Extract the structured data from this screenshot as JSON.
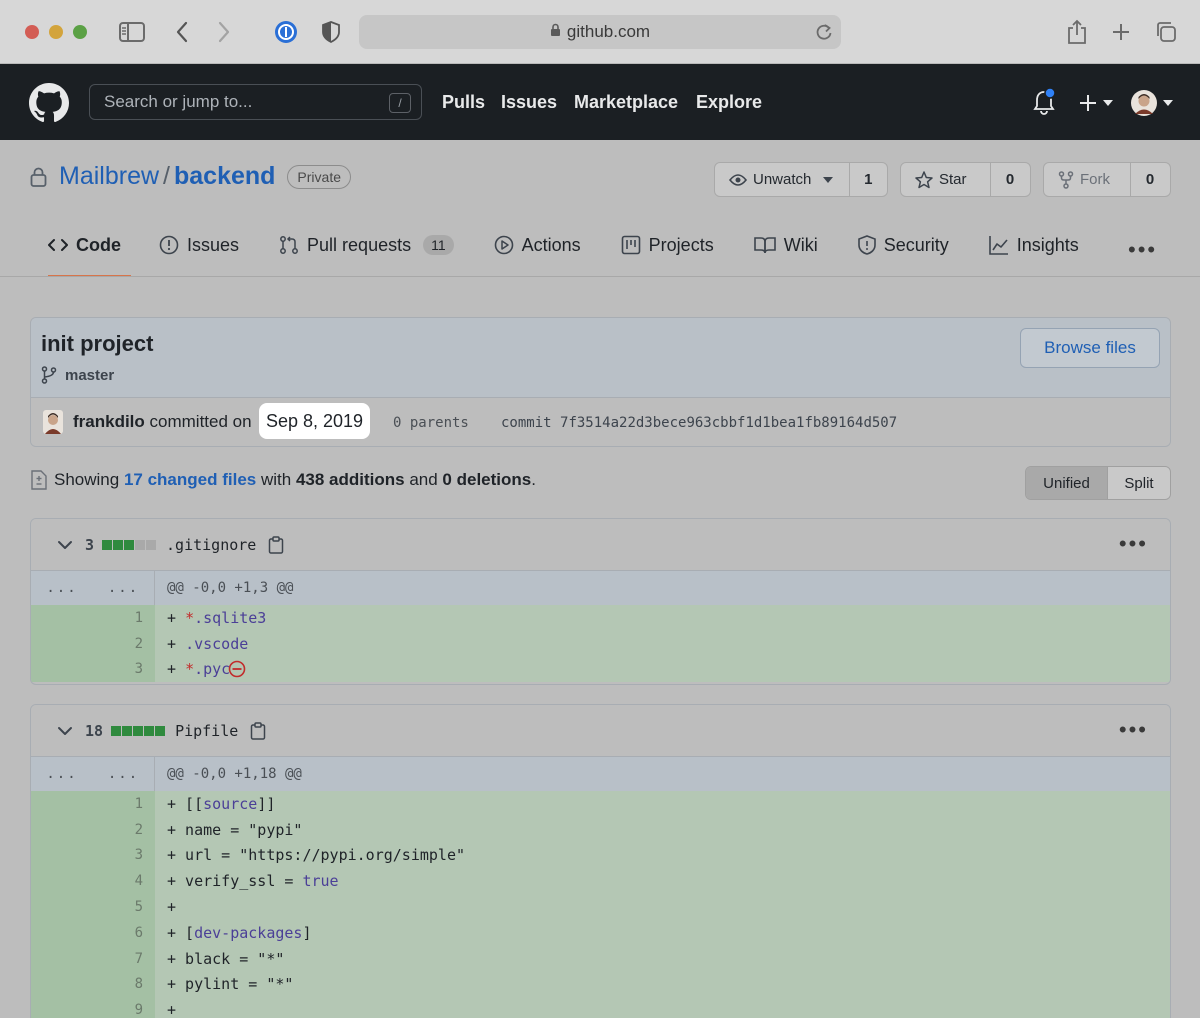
{
  "browser": {
    "url": "github.com"
  },
  "nav": {
    "search_placeholder": "Search or jump to...",
    "search_shortcut": "/",
    "links": [
      "Pulls",
      "Issues",
      "Marketplace",
      "Explore"
    ]
  },
  "repo": {
    "owner": "Mailbrew",
    "separator": "/",
    "name": "backend",
    "visibility": "Private",
    "unwatch_label": "Unwatch",
    "watch_count": "1",
    "star_label": "Star",
    "star_count": "0",
    "fork_label": "Fork",
    "fork_count": "0"
  },
  "tabs": [
    {
      "label": "Code",
      "icon": "code-icon"
    },
    {
      "label": "Issues",
      "icon": "issue-icon"
    },
    {
      "label": "Pull requests",
      "icon": "pull-request-icon",
      "count": "11"
    },
    {
      "label": "Actions",
      "icon": "play-icon"
    },
    {
      "label": "Projects",
      "icon": "project-icon"
    },
    {
      "label": "Wiki",
      "icon": "book-icon"
    },
    {
      "label": "Security",
      "icon": "shield-icon"
    },
    {
      "label": "Insights",
      "icon": "graph-icon"
    }
  ],
  "commit": {
    "title": "init project",
    "branch": "master",
    "browse_label": "Browse files",
    "author": "frankdilo",
    "committed_on": "committed on",
    "date": "Sep 8, 2019",
    "parents": "0 parents",
    "sha_label": "commit",
    "sha": "7f3514a22d3bece963cbbf1d1bea1fb89164d507"
  },
  "summary": {
    "showing": "Showing",
    "changed_files": "17 changed files",
    "with": "with",
    "additions": "438 additions",
    "and": "and",
    "deletions": "0 deletions",
    "end": "."
  },
  "view": {
    "unified": "Unified",
    "split": "Split"
  },
  "colors": {
    "addition": "#2f8a3e",
    "neutral": "#a9a9a9",
    "link": "#1f5fb4"
  },
  "files": [
    {
      "count": "3",
      "name": ".gitignore",
      "hunk": "@@ -0,0 +1,3 @@",
      "hunk_left": "...",
      "hunk_right": "...",
      "lines": [
        {
          "n": "1",
          "text": "+ *.sqlite3"
        },
        {
          "n": "2",
          "text": "+ .vscode"
        },
        {
          "n": "3",
          "text": "+ *.pyc"
        }
      ]
    },
    {
      "count": "18",
      "name": "Pipfile",
      "hunk": "@@ -0,0 +1,18 @@",
      "hunk_left": "...",
      "hunk_right": "...",
      "lines": [
        {
          "n": "1",
          "text": "+ [[source]]"
        },
        {
          "n": "2",
          "text": "+ name = \"pypi\""
        },
        {
          "n": "3",
          "text": "+ url = \"https://pypi.org/simple\""
        },
        {
          "n": "4",
          "text": "+ verify_ssl = true"
        },
        {
          "n": "5",
          "text": "+"
        },
        {
          "n": "6",
          "text": "+ [dev-packages]"
        },
        {
          "n": "7",
          "text": "+ black = \"*\""
        },
        {
          "n": "8",
          "text": "+ pylint = \"*\""
        },
        {
          "n": "9",
          "text": "+"
        }
      ]
    }
  ]
}
